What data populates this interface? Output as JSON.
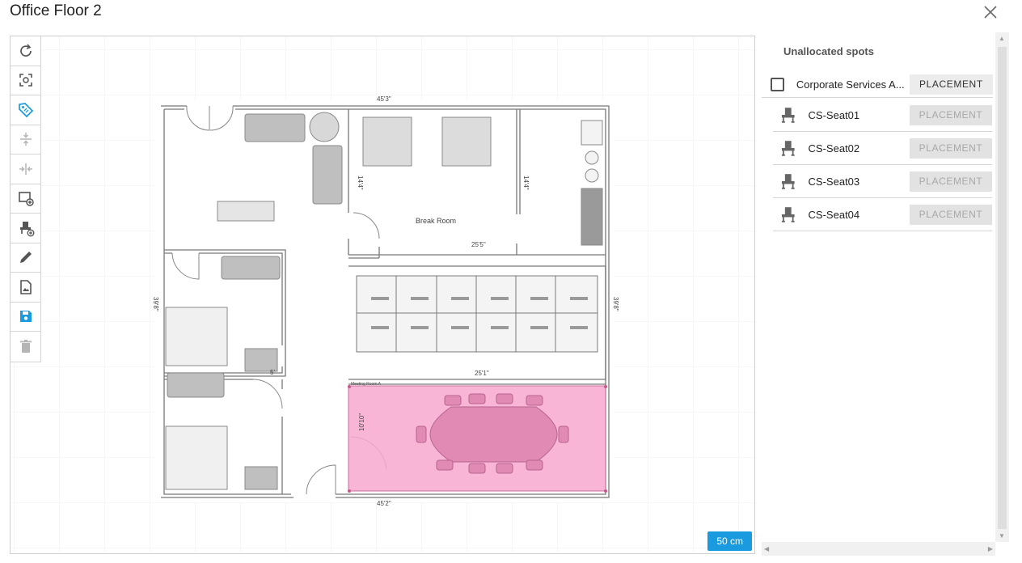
{
  "header": {
    "title": "Office Floor 2",
    "close_icon": "close-icon"
  },
  "toolbar": {
    "tools": [
      {
        "name": "rotate",
        "icon": "rotate-icon"
      },
      {
        "name": "fit-view",
        "icon": "focus-frame-icon"
      },
      {
        "name": "tag",
        "icon": "tag-icon",
        "active": true
      },
      {
        "name": "compress-vertical",
        "icon": "compress-vertical-icon",
        "disabled": true
      },
      {
        "name": "compress-horizontal",
        "icon": "compress-horizontal-icon",
        "disabled": true
      },
      {
        "name": "add-area",
        "icon": "add-area-icon"
      },
      {
        "name": "add-seat",
        "icon": "add-seat-icon"
      },
      {
        "name": "edit",
        "icon": "pencil-icon"
      },
      {
        "name": "image",
        "icon": "image-file-icon"
      },
      {
        "name": "save",
        "icon": "save-icon",
        "active": true
      },
      {
        "name": "delete",
        "icon": "trash-icon",
        "disabled": true
      }
    ]
  },
  "floorplan": {
    "dim_top": "45'3\"",
    "dim_break_room_bottom": "25'5\"",
    "dim_left": "39'8\"",
    "dim_right": "39'8\"",
    "dim_break_left": "14'4\"",
    "dim_break_right": "14'4\"",
    "dim_workstations_bottom": "25'1\"",
    "dim_meeting_left": "10'10\"",
    "dim_bottom": "45'2\"",
    "dim_small": "5'",
    "break_room_label": "Break Room",
    "meeting_room_label": "Meeting Room A",
    "highlight_color": "#f7a8cf"
  },
  "scale": {
    "label": "50 cm",
    "color": "#1a9be0"
  },
  "panel": {
    "title": "Unallocated spots",
    "group": {
      "label": "Corporate Services A...",
      "button": "PLACEMENT",
      "checked": false
    },
    "seats": [
      {
        "label": "CS-Seat01",
        "button": "PLACEMENT",
        "icon": "seat-icon"
      },
      {
        "label": "CS-Seat02",
        "button": "PLACEMENT",
        "icon": "seat-icon"
      },
      {
        "label": "CS-Seat03",
        "button": "PLACEMENT",
        "icon": "seat-icon"
      },
      {
        "label": "CS-Seat04",
        "button": "PLACEMENT",
        "icon": "seat-icon"
      }
    ]
  }
}
